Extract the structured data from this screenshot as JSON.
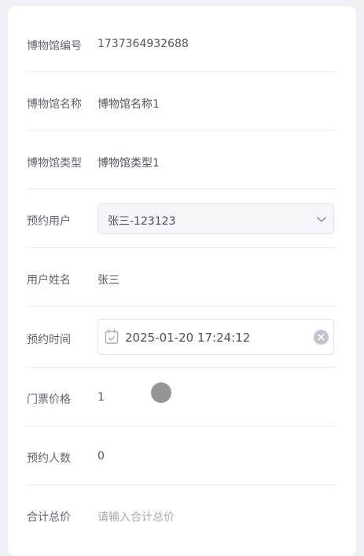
{
  "form": {
    "museum_id": {
      "label": "博物馆编号",
      "value": "1737364932688"
    },
    "museum_name": {
      "label": "博物馆名称",
      "value": "博物馆名称1"
    },
    "museum_type": {
      "label": "博物馆类型",
      "value": "博物馆类型1"
    },
    "reserve_user": {
      "label": "预约用户",
      "value": "张三-123123"
    },
    "user_name": {
      "label": "用户姓名",
      "value": "张三"
    },
    "reserve_time": {
      "label": "预约时间",
      "value": "2025-01-20 17:24:12"
    },
    "ticket_price": {
      "label": "门票价格",
      "value": "1"
    },
    "reserve_count": {
      "label": "预约人数",
      "value": "0"
    },
    "total_price": {
      "label": "合计总价",
      "placeholder": "请输入合计总价"
    }
  },
  "icons": {
    "select_chevron": "chevron-down-icon",
    "calendar": "calendar-icon",
    "clear": "clear-icon"
  },
  "colors": {
    "background": "#eef0f3",
    "card": "#ffffff",
    "label": "#5f6470",
    "value": "#505560",
    "placeholder": "#a4a8b0",
    "divider": "#e9ebef"
  }
}
